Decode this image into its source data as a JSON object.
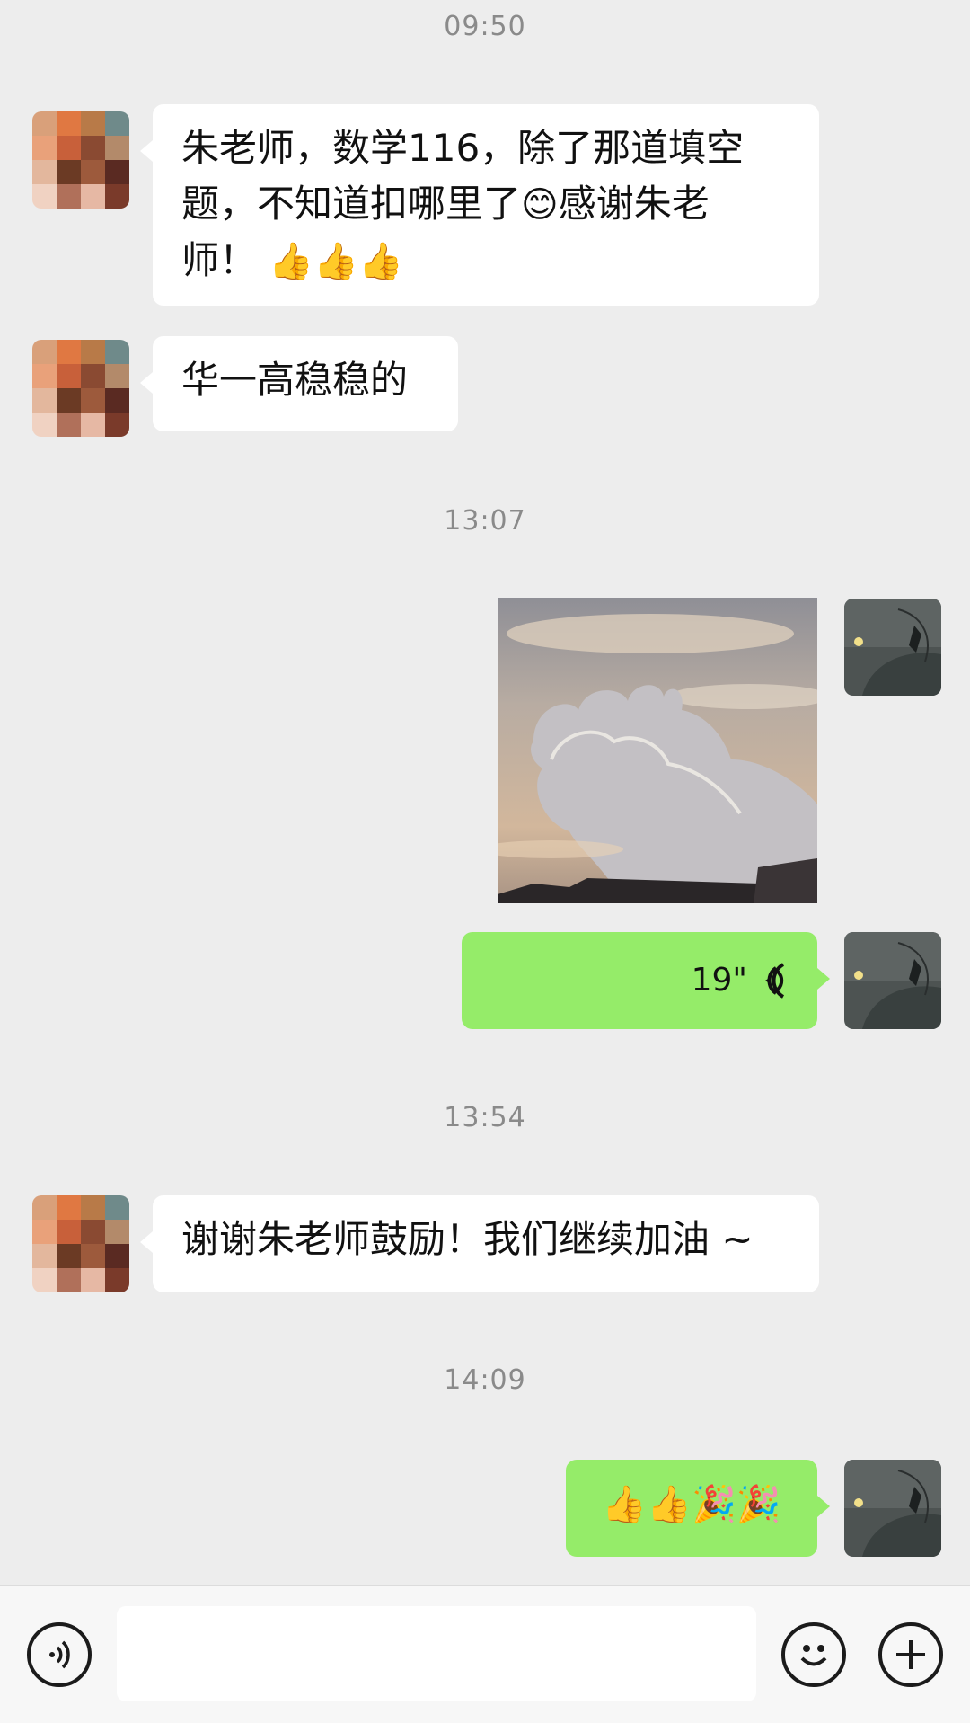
{
  "timestamps": [
    "09:50",
    "13:07",
    "13:54",
    "14:09"
  ],
  "messages": {
    "m1": {
      "text_line1": "朱老师，数学116，除了那道填空",
      "text_line2a": "题，不知道扣哪里了",
      "emoji_smile": "😊",
      "text_line2b": "感谢朱老师！",
      "text_line3": "师！",
      "emoji_thumbs": "👍👍👍"
    },
    "m2": {
      "text": "华一高稳稳的"
    },
    "m3_voice": {
      "duration": "19\""
    },
    "m4": {
      "text": "谢谢朱老师鼓励！我们继续加油 ~"
    },
    "m5": {
      "emojis": "👍👍🎉🎉"
    }
  },
  "icons": {
    "voice_toggle": "voice-input-icon",
    "emoji": "emoji-face-icon",
    "plus": "plus-circle-icon",
    "voice_wave": "voice-wave-icon"
  },
  "colors": {
    "background": "#ededed",
    "incoming_bubble": "#ffffff",
    "outgoing_bubble": "#95ec69",
    "timestamp": "#8a8a8a"
  }
}
